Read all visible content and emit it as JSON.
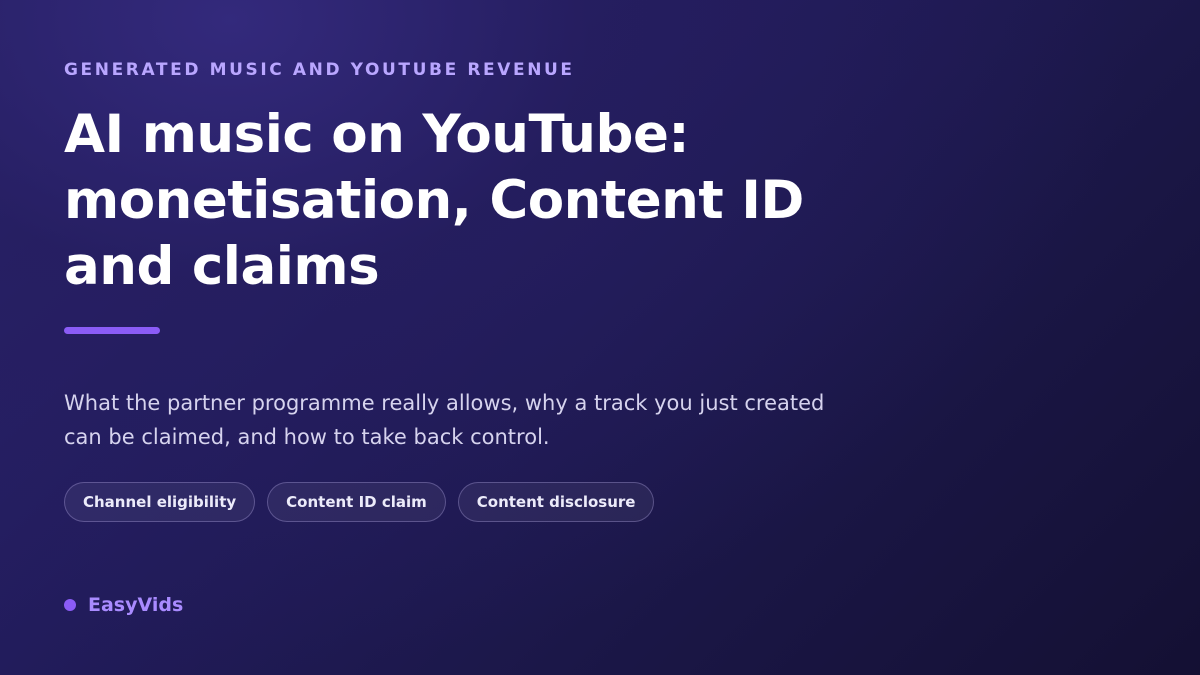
{
  "eyebrow": "GENERATED MUSIC AND YOUTUBE REVENUE",
  "title_lines": [
    "AI music on YouTube:",
    "monetisation, Content ID",
    "and claims"
  ],
  "subtitle_lines": [
    "What the partner programme really allows, why a track you just created",
    "can be claimed, and how to take back control."
  ],
  "tags": [
    "Channel eligibility",
    "Content ID claim",
    "Content disclosure"
  ],
  "brand": {
    "name": "EasyVids",
    "icon": "dot-icon"
  },
  "colors": {
    "accent": "#8b5cf6",
    "eyebrow": "#b9a6ff",
    "brand_text": "#a98bff",
    "background_dark": "#141033",
    "background_light": "#342a7d"
  }
}
